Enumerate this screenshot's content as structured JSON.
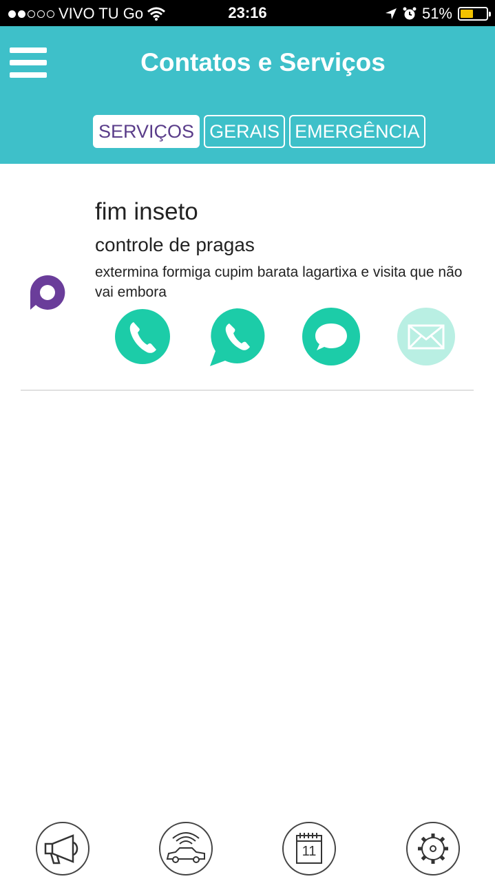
{
  "status_bar": {
    "carrier": "VIVO TU Go",
    "time": "23:16",
    "battery_percent": "51%",
    "battery_level": 0.51,
    "signal_bars": 2,
    "icons": [
      "wifi-icon",
      "location-arrow-icon",
      "alarm-icon",
      "battery-icon"
    ]
  },
  "header": {
    "title": "Contatos e Serviços",
    "menu_icon": "hamburger-menu-icon",
    "background_color": "#3ec0c9",
    "tabs": [
      {
        "label": "SERVIÇOS",
        "active": true
      },
      {
        "label": "GERAIS",
        "active": false
      },
      {
        "label": "EMERGÊNCIA",
        "active": false
      }
    ]
  },
  "contact": {
    "name": "fim inseto",
    "category": "controle de pragas",
    "description": "extermina formiga cupim barata lagartixa e visita que não vai embora",
    "brand_icon": "speech-bubble-logo-icon",
    "brand_color": "#6a3d9a",
    "actions": [
      {
        "icon": "phone-icon",
        "enabled": true
      },
      {
        "icon": "whatsapp-icon",
        "enabled": true
      },
      {
        "icon": "message-icon",
        "enabled": true
      },
      {
        "icon": "email-icon",
        "enabled": false
      }
    ],
    "action_color": "#1ccca8",
    "action_disabled_color": "#b9efe3"
  },
  "bottom_nav": [
    {
      "icon": "megaphone-icon"
    },
    {
      "icon": "car-wifi-icon"
    },
    {
      "icon": "calendar-icon",
      "day": "11"
    },
    {
      "icon": "settings-gear-icon"
    }
  ]
}
